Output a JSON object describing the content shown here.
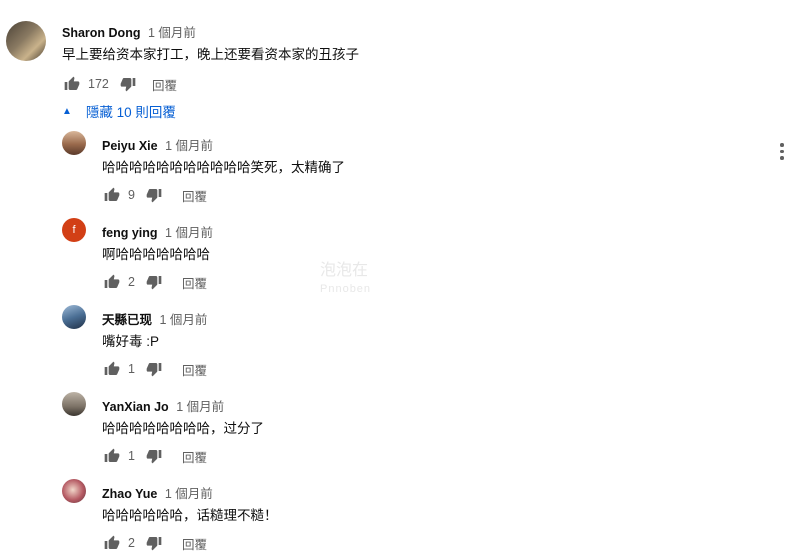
{
  "top_comment": {
    "author": "Sharon Dong",
    "time": "1 個月前",
    "text": "早上要给资本家打工，晚上还要看资本家的丑孩子",
    "likes": "172",
    "reply_label": "回覆"
  },
  "replies_toggle": {
    "label": "隱藏 10 則回覆"
  },
  "watermark": {
    "line1": "泡泡在",
    "line2": "Pnnoben"
  },
  "replies": [
    {
      "author": "Peiyu Xie",
      "time": "1 個月前",
      "text": "哈哈哈哈哈哈哈哈哈哈哈笑死，太精确了",
      "likes": "9",
      "reply_label": "回覆",
      "avatar_color": "#9a6a4c"
    },
    {
      "author": "feng ying",
      "time": "1 個月前",
      "text": "啊哈哈哈哈哈哈哈",
      "likes": "2",
      "reply_label": "回覆",
      "avatar_letter": "f",
      "avatar_color": "#d23f15"
    },
    {
      "author": "天縣已现",
      "time": "1 個月前",
      "text": "嘴好毒 :P",
      "likes": "1",
      "reply_label": "回覆",
      "avatar_color": "#4b6f95"
    },
    {
      "author": "YanXian Jo",
      "time": "1 個月前",
      "text": "哈哈哈哈哈哈哈哈，过分了",
      "likes": "1",
      "reply_label": "回覆",
      "avatar_color": "#7d7367"
    },
    {
      "author": "Zhao Yue",
      "time": "1 個月前",
      "text": "哈哈哈哈哈哈，话糙理不糙！",
      "likes": "2",
      "reply_label": "回覆",
      "avatar_color": "#b55a63"
    }
  ]
}
